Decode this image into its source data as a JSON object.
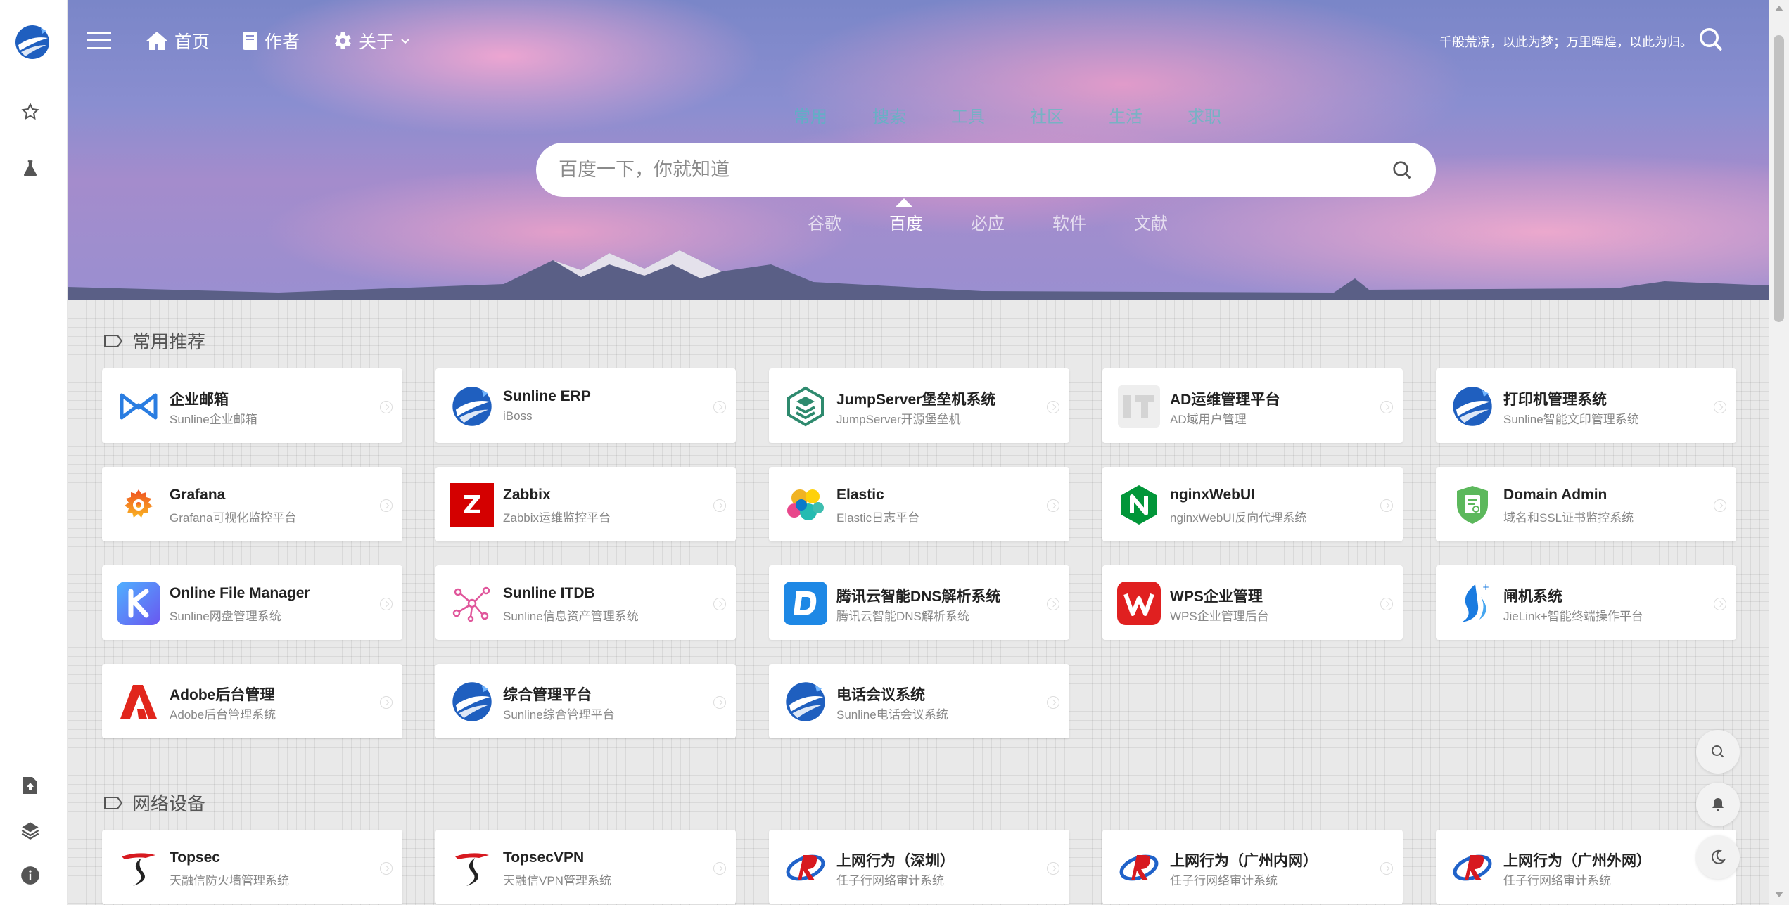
{
  "nav": {
    "home": "首页",
    "author": "作者",
    "about": "关于",
    "motto": "千般荒凉，以此为梦；万里晖煌，以此为归。"
  },
  "search": {
    "categories": [
      "常用",
      "搜索",
      "工具",
      "社区",
      "生活",
      "求职"
    ],
    "placeholder": "百度一下，你就知道",
    "engines": [
      "谷歌",
      "百度",
      "必应",
      "软件",
      "文献"
    ],
    "active_engine": "百度"
  },
  "sections": [
    {
      "title": "常用推荐",
      "cards": [
        {
          "name": "企业邮箱",
          "desc": "Sunline企业邮箱",
          "icon": "mail-brand-icon"
        },
        {
          "name": "Sunline ERP",
          "desc": "iBoss",
          "icon": "sunline-logo-icon"
        },
        {
          "name": "JumpServer堡垒机系统",
          "desc": "JumpServer开源堡垒机",
          "icon": "jumpserver-icon"
        },
        {
          "name": "AD运维管理平台",
          "desc": "AD域用户管理",
          "icon": "it-icon"
        },
        {
          "name": "打印机管理系统",
          "desc": "Sunline智能文印管理系统",
          "icon": "sunline-logo-icon"
        },
        {
          "name": "Grafana",
          "desc": "Grafana可视化监控平台",
          "icon": "grafana-icon"
        },
        {
          "name": "Zabbix",
          "desc": "Zabbix运维监控平台",
          "icon": "zabbix-icon"
        },
        {
          "name": "Elastic",
          "desc": "Elastic日志平台",
          "icon": "elastic-icon"
        },
        {
          "name": "nginxWebUI",
          "desc": "nginxWebUI反向代理系统",
          "icon": "nginx-icon"
        },
        {
          "name": "Domain Admin",
          "desc": "域名和SSL证书监控系统",
          "icon": "domain-shield-icon"
        },
        {
          "name": "Online File Manager",
          "desc": "Sunline网盘管理系统",
          "icon": "kodbox-icon"
        },
        {
          "name": "Sunline ITDB",
          "desc": "Sunline信息资产管理系统",
          "icon": "itdb-network-icon"
        },
        {
          "name": "腾讯云智能DNS解析系统",
          "desc": "腾讯云智能DNS解析系统",
          "icon": "dnspod-icon"
        },
        {
          "name": "WPS企业管理",
          "desc": "WPS企业管理后台",
          "icon": "wps-icon"
        },
        {
          "name": "闸机系统",
          "desc": "JieLink+智能终端操作平台",
          "icon": "jielink-icon"
        },
        {
          "name": "Adobe后台管理",
          "desc": "Adobe后台管理系统",
          "icon": "adobe-icon"
        },
        {
          "name": "综合管理平台",
          "desc": "Sunline综合管理平台",
          "icon": "sunline-logo-icon"
        },
        {
          "name": "电话会议系统",
          "desc": "Sunline电话会议系统",
          "icon": "sunline-logo-icon"
        }
      ]
    },
    {
      "title": "网络设备",
      "cards": [
        {
          "name": "Topsec",
          "desc": "天融信防火墙管理系统",
          "icon": "topsec-icon"
        },
        {
          "name": "TopsecVPN",
          "desc": "天融信VPN管理系统",
          "icon": "topsec-icon"
        },
        {
          "name": "上网行为（深圳）",
          "desc": "任子行网络审计系统",
          "icon": "surfilter-icon"
        },
        {
          "name": "上网行为（广州内网）",
          "desc": "任子行网络审计系统",
          "icon": "surfilter-icon"
        },
        {
          "name": "上网行为（广州外网）",
          "desc": "任子行网络审计系统",
          "icon": "surfilter-icon"
        }
      ]
    }
  ],
  "colors": {
    "brand_blue": "#1f5fbf",
    "content_bg": "#e9e9e9"
  }
}
